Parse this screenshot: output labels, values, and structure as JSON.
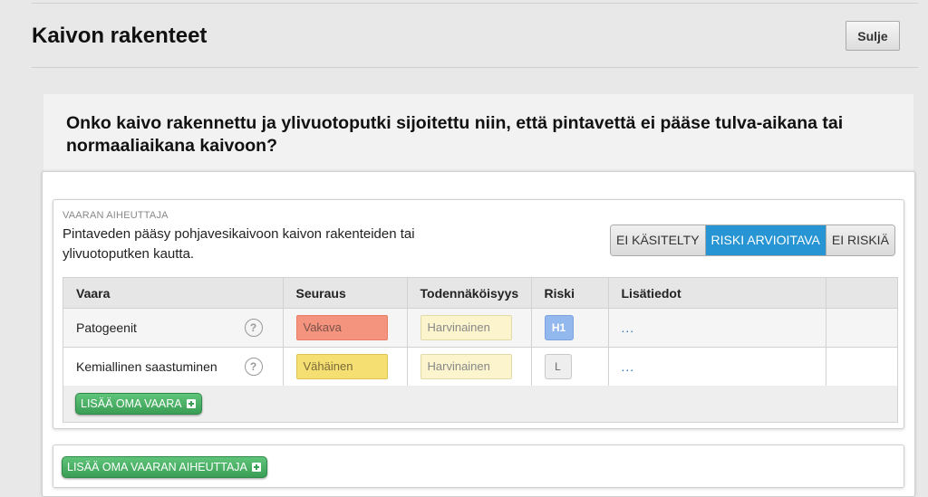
{
  "header": {
    "title": "Kaivon rakenteet",
    "close_label": "Sulje"
  },
  "question": {
    "text": "Onko kaivo rakennettu ja ylivuotoputki sijoitettu niin, että pintavettä ei pääse tulva-aikana tai normaaliaikana kaivoon?"
  },
  "hazard_source": {
    "label": "VAARAN AIHEUTTAJA",
    "description": "Pintaveden pääsy pohjavesikaivoon kaivon rakenteiden tai ylivuotoputken kautta.",
    "status_options": [
      "EI KÄSITELTY",
      "RISKI ARVIOITAVA",
      "EI RISKIÄ"
    ],
    "selected_status": "RISKI ARVIOITAVA"
  },
  "table": {
    "headers": [
      "Vaara",
      "Seuraus",
      "Todennäköisyys",
      "Riski",
      "Lisätiedot",
      ""
    ],
    "rows": [
      {
        "hazard": "Patogeenit",
        "consequence": "Vakava",
        "probability": "Harvinainen",
        "risk": "H1",
        "info": "..."
      },
      {
        "hazard": "Kemiallinen saastuminen",
        "consequence": "Vähäinen",
        "probability": "Harvinainen",
        "risk": "L",
        "info": "..."
      }
    ],
    "help_glyph": "?",
    "add_hazard_label": "LISÄÄ OMA VAARA"
  },
  "add_source_label": "LISÄÄ OMA VAARAN AIHEUTTAJA",
  "colors": {
    "active_toggle": "#2795d3",
    "green_button": "#3a9d55",
    "serious": "#f4947e",
    "minor": "#f5de72",
    "risk_h1": "#93b8ee"
  }
}
